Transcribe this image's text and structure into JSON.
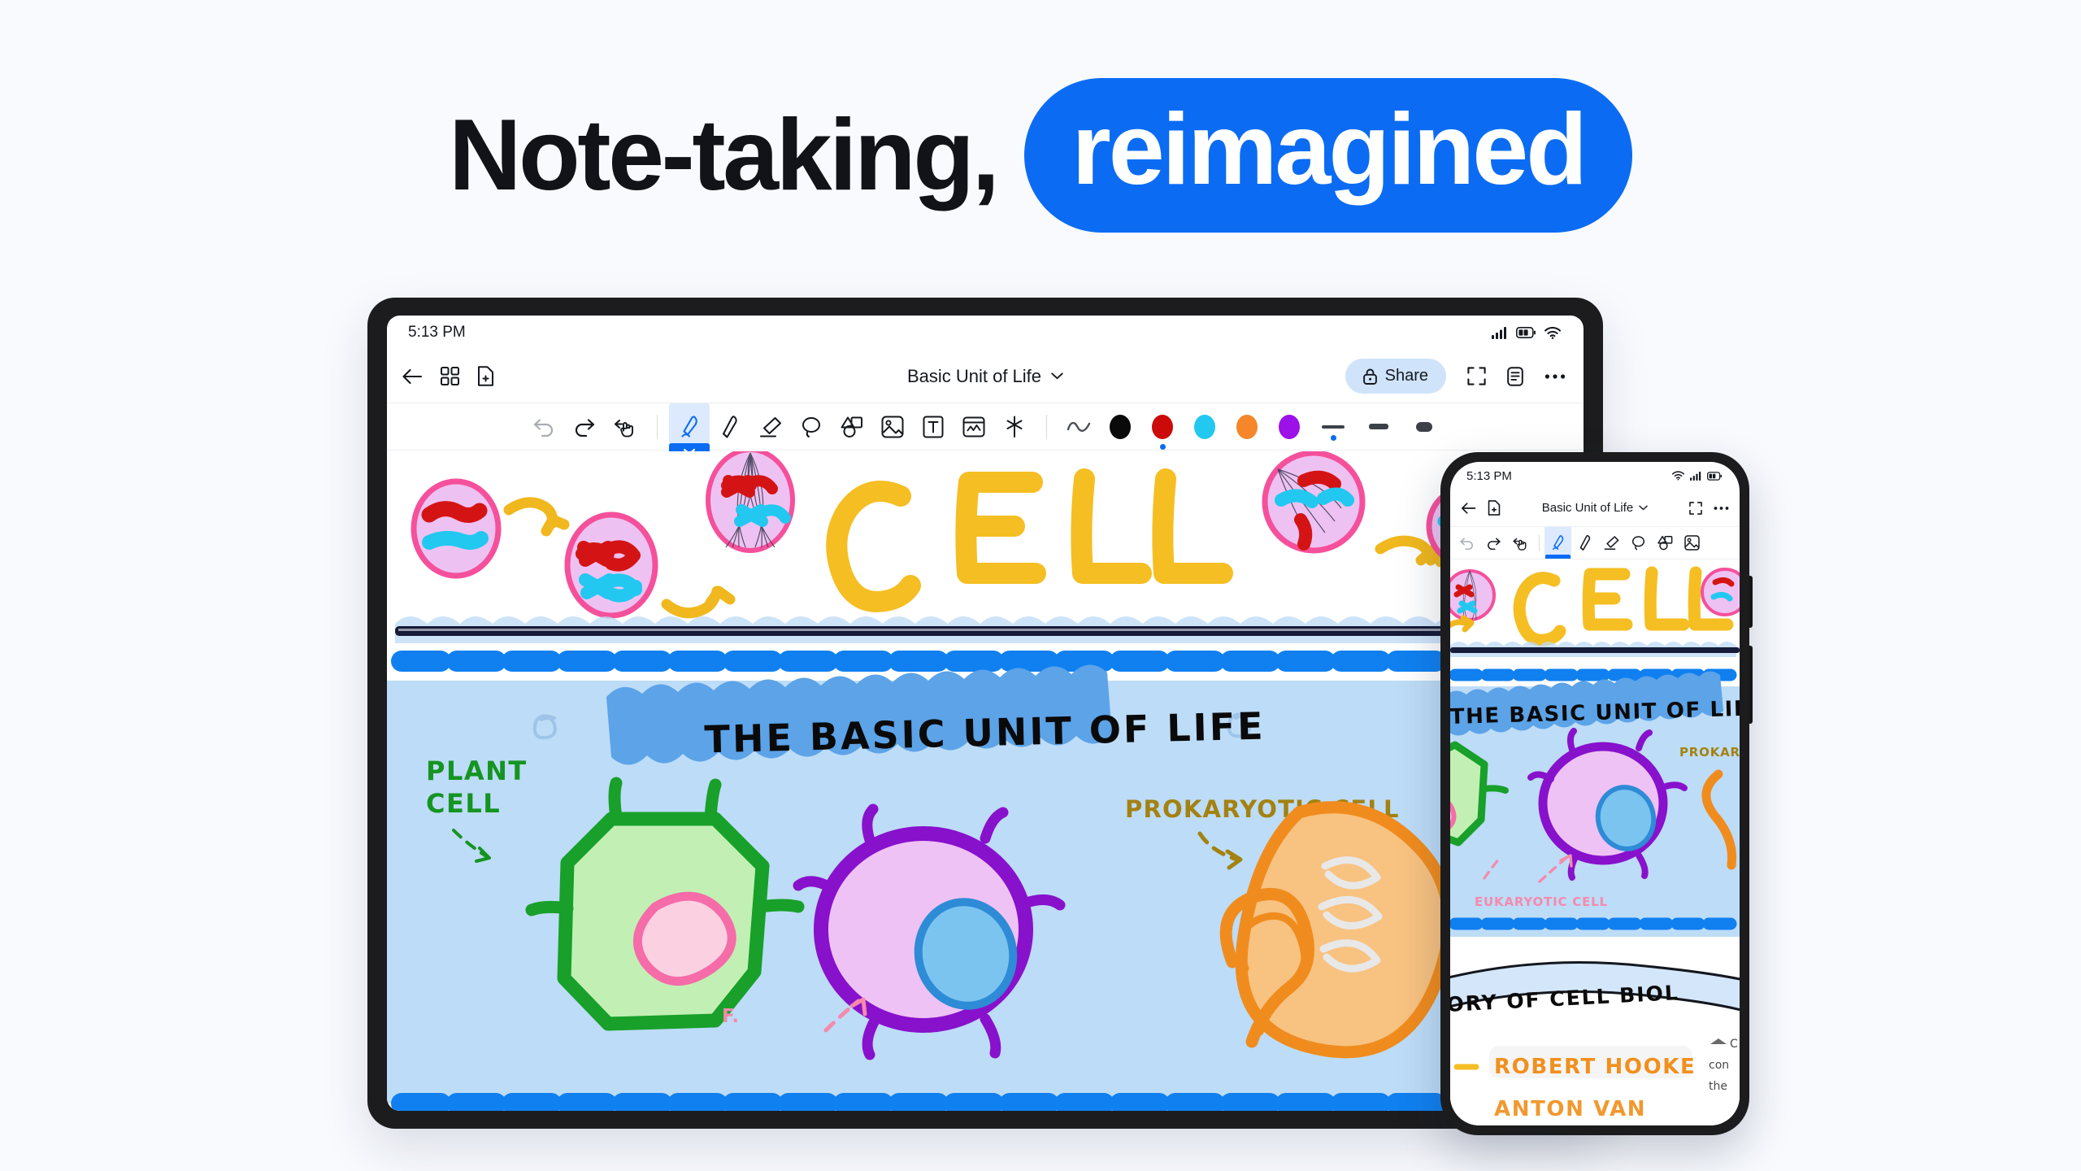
{
  "headline": {
    "plain": "Note-taking,",
    "highlight": "reimagined",
    "highlight_color": "#0B6CF3",
    "text_color": "#111318",
    "background": "#F8FAFE"
  },
  "tablet": {
    "status": {
      "time": "5:13 PM",
      "icons": [
        "cellular-signal-icon",
        "battery-icon",
        "wifi-icon"
      ]
    },
    "navbar": {
      "back_icon": "back-arrow-icon",
      "grid_icon": "page-grid-icon",
      "new_page_icon": "new-page-icon",
      "title": "Basic Unit of Life",
      "title_chevron": "chevron-down-icon",
      "share_label": "Share",
      "share_icon": "lock-icon",
      "share_bg": "#CFE3FB",
      "fullscreen_icon": "fullscreen-icon",
      "outline_icon": "document-outline-icon",
      "more_icon": "more-horizontal-icon"
    },
    "toolbar": {
      "history": [
        "undo-icon",
        "redo-icon",
        "hand-select-icon"
      ],
      "tools": [
        {
          "name": "pen-tool",
          "icon": "pen-icon",
          "active": true
        },
        {
          "name": "pencil-tool",
          "icon": "pencil-icon",
          "active": false
        },
        {
          "name": "eraser-tool",
          "icon": "eraser-icon",
          "active": false
        },
        {
          "name": "lasso-tool",
          "icon": "lasso-icon",
          "active": false
        },
        {
          "name": "shapes-tool",
          "icon": "shapes-icon",
          "active": false
        },
        {
          "name": "image-tool",
          "icon": "image-icon",
          "active": false
        },
        {
          "name": "text-tool",
          "icon": "text-box-icon",
          "active": false
        },
        {
          "name": "sticker-tool",
          "icon": "sticker-icon",
          "active": false
        },
        {
          "name": "ai-tool",
          "icon": "sparkle-icon",
          "active": false
        }
      ],
      "shape_recognize_icon": "squiggle-icon",
      "colors": [
        {
          "name": "black",
          "hex": "#0A0A0A",
          "selected": false
        },
        {
          "name": "red",
          "hex": "#CC0A0A",
          "selected": true
        },
        {
          "name": "cyan",
          "hex": "#22C8F0",
          "selected": false
        },
        {
          "name": "orange",
          "hex": "#F5862A",
          "selected": false
        },
        {
          "name": "purple",
          "hex": "#9B11E8",
          "selected": false
        }
      ],
      "weights": [
        {
          "name": "thin",
          "px": 4,
          "selected": true
        },
        {
          "name": "medium",
          "px": 7,
          "selected": false
        },
        {
          "name": "thick",
          "px": 12,
          "selected": false
        }
      ]
    },
    "canvas": {
      "title_word": "CELL",
      "title_color": "#F5BE22",
      "banner_text": "THE BASIC UNIT OF LIFE",
      "banner_highlight": "#5CA3E8",
      "section_bg": "#BDDCF7",
      "divider_color": "#1080F0",
      "labels": [
        {
          "text": "PLANT",
          "color": "#159422"
        },
        {
          "text": "CELL",
          "color": "#159422"
        },
        {
          "text": "PROKARYOTIC CELL",
          "color": "#A38211"
        }
      ],
      "cells": {
        "plant": {
          "stroke": "#18A02A",
          "fill": "#C2F0B4",
          "nucleus_stroke": "#F56CA8",
          "nucleus_fill": "#FBD0E0"
        },
        "eukaryotic": {
          "stroke": "#8811CC",
          "fill": "#EEC2F5",
          "nucleus_stroke": "#2E8BD6",
          "nucleus_fill": "#7CC4F0"
        },
        "prokaryotic": {
          "stroke": "#F08C1E",
          "fill": "#F8C281"
        },
        "mitosis": {
          "stroke": "#F5509B",
          "fill": "#EDC2F2",
          "chromo_red": "#D41414",
          "chromo_cyan": "#22C8F0",
          "arrow": "#F0B81E"
        }
      }
    }
  },
  "phone": {
    "status": {
      "time": "5:13 PM",
      "icons": [
        "wifi-icon",
        "cellular-signal-icon",
        "battery-icon"
      ]
    },
    "navbar": {
      "back_icon": "back-arrow-icon",
      "new_page_icon": "new-page-icon",
      "title": "Basic Unit of Life",
      "title_chevron": "chevron-down-icon",
      "fullscreen_icon": "fullscreen-icon",
      "more_icon": "more-horizontal-icon"
    },
    "toolbar": {
      "history": [
        "undo-icon",
        "redo-icon",
        "hand-select-icon"
      ],
      "tools": [
        {
          "name": "pen-tool",
          "icon": "pen-icon",
          "active": true
        },
        {
          "name": "pencil-tool",
          "icon": "pencil-icon",
          "active": false
        },
        {
          "name": "eraser-tool",
          "icon": "eraser-icon",
          "active": false
        },
        {
          "name": "lasso-tool",
          "icon": "lasso-icon",
          "active": false
        },
        {
          "name": "shapes-tool",
          "icon": "shapes-icon",
          "active": false
        },
        {
          "name": "image-tool",
          "icon": "image-icon",
          "active": false
        }
      ]
    },
    "canvas": {
      "title_word": "CELL",
      "banner_text": "THE BASIC UNIT OF LIF",
      "section2_banner": "ORY OF CELL BIOL",
      "labels": [
        {
          "text": "PROKARY",
          "color": "#A38211"
        },
        {
          "text": "EUKARYOTIC CELL",
          "color": "#F58AAD"
        },
        {
          "text": "ROBERT HOOKE",
          "color": "#F0901E"
        },
        {
          "text": "ANTON VAN",
          "color": "#F0901E"
        }
      ],
      "side_note_lines": [
        "C",
        "con",
        "the"
      ]
    }
  }
}
